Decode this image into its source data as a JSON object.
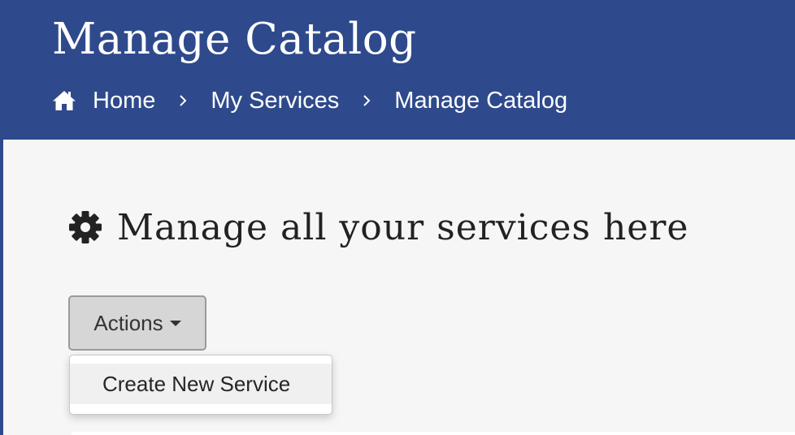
{
  "header": {
    "title": "Manage Catalog",
    "background_color": "#2e4a8c"
  },
  "breadcrumb": {
    "home_icon": "home-icon",
    "separator_icon": "chevron-right-icon",
    "items": [
      {
        "label": "Home"
      },
      {
        "label": "My Services"
      },
      {
        "label": "Manage Catalog"
      }
    ]
  },
  "main": {
    "heading_icon": "gear-icon",
    "heading": "Manage all your services here",
    "actions": {
      "label": "Actions",
      "caret_icon": "caret-down-icon",
      "menu_items": [
        {
          "label": "Create New Service"
        }
      ]
    }
  }
}
